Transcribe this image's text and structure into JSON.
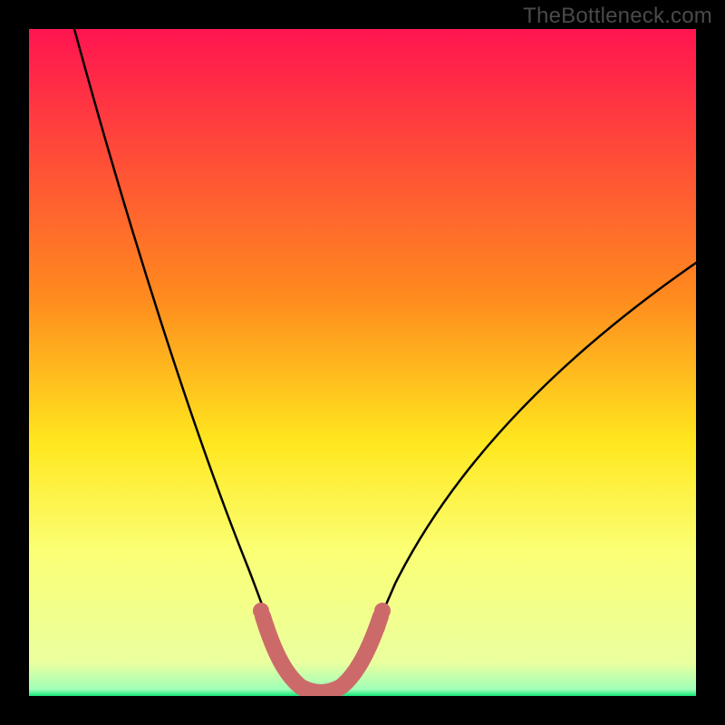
{
  "watermark": "TheBottleneck.com",
  "chart_data": {
    "type": "line",
    "title": "",
    "xlabel": "",
    "ylabel": "",
    "xlim": [
      0,
      100
    ],
    "ylim": [
      0,
      100
    ],
    "gradient_stops": [
      {
        "offset": 0,
        "color": "#ff1450"
      },
      {
        "offset": 40,
        "color": "#ff8a1e"
      },
      {
        "offset": 62,
        "color": "#ffe71e"
      },
      {
        "offset": 78,
        "color": "#fbff73"
      },
      {
        "offset": 95,
        "color": "#eaff9f"
      },
      {
        "offset": 100,
        "color": "#14e67a"
      }
    ],
    "series": [
      {
        "name": "bottleneck-curve",
        "type": "curve",
        "control_points": [
          {
            "x": 7,
            "y": 100
          },
          {
            "x": 16,
            "y": 70
          },
          {
            "x": 26,
            "y": 40
          },
          {
            "x": 33,
            "y": 18
          },
          {
            "x": 36,
            "y": 8
          },
          {
            "x": 40,
            "y": 1
          },
          {
            "x": 44,
            "y": 0
          },
          {
            "x": 48,
            "y": 1
          },
          {
            "x": 52,
            "y": 7
          },
          {
            "x": 60,
            "y": 20
          },
          {
            "x": 74,
            "y": 40
          },
          {
            "x": 100,
            "y": 65
          }
        ]
      },
      {
        "name": "optimal-zone-marker",
        "type": "u-shape",
        "color": "#cc6a6a",
        "points": [
          {
            "x": 35,
            "y": 12
          },
          {
            "x": 37,
            "y": 5
          },
          {
            "x": 40,
            "y": 1
          },
          {
            "x": 44,
            "y": 0
          },
          {
            "x": 48,
            "y": 1
          },
          {
            "x": 51,
            "y": 6
          },
          {
            "x": 53,
            "y": 12
          }
        ]
      }
    ]
  }
}
